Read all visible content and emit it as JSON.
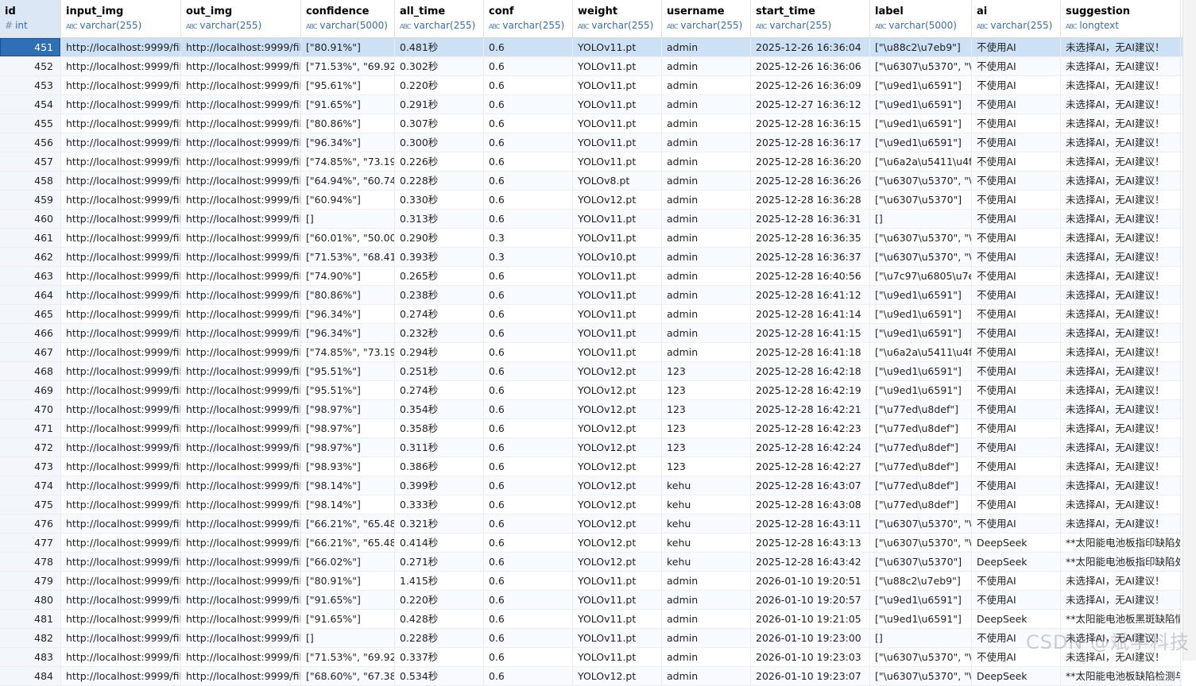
{
  "columns": [
    {
      "name": "id",
      "type": "int",
      "icon": "#"
    },
    {
      "name": "input_img",
      "type": "varchar(255)",
      "icon": "ABC"
    },
    {
      "name": "out_img",
      "type": "varchar(255)",
      "icon": "ABC"
    },
    {
      "name": "confidence",
      "type": "varchar(5000)",
      "icon": "ABC"
    },
    {
      "name": "all_time",
      "type": "varchar(255)",
      "icon": "ABC"
    },
    {
      "name": "conf",
      "type": "varchar(255)",
      "icon": "ABC"
    },
    {
      "name": "weight",
      "type": "varchar(255)",
      "icon": "ABC"
    },
    {
      "name": "username",
      "type": "varchar(255)",
      "icon": "ABC"
    },
    {
      "name": "start_time",
      "type": "varchar(255)",
      "icon": "ABC"
    },
    {
      "name": "label",
      "type": "varchar(5000)",
      "icon": "ABC"
    },
    {
      "name": "ai",
      "type": "varchar(255)",
      "icon": "ABC"
    },
    {
      "name": "suggestion",
      "type": "longtext",
      "icon": "ABC"
    }
  ],
  "rows": [
    [
      "451",
      "http://localhost:9999/file",
      "http://localhost:9999/file",
      "[\"80.91%\"]",
      "0.481秒",
      "0.6",
      "YOLOv11.pt",
      "admin",
      "2025-12-26 16:36:04",
      "[\"\\u88c2\\u7eb9\"]",
      "不使用AI",
      "未选择AI，无AI建议！"
    ],
    [
      "452",
      "http://localhost:9999/file",
      "http://localhost:9999/file",
      "[\"71.53%\", \"69.92%",
      "0.302秒",
      "0.6",
      "YOLOv11.pt",
      "admin",
      "2025-12-26 16:36:06",
      "[\"\\u6307\\u5370\", \"\\u",
      "不使用AI",
      "未选择AI，无AI建议！"
    ],
    [
      "453",
      "http://localhost:9999/file",
      "http://localhost:9999/file",
      "[\"95.61%\"]",
      "0.220秒",
      "0.6",
      "YOLOv11.pt",
      "admin",
      "2025-12-26 16:36:09",
      "[\"\\u9ed1\\u6591\"]",
      "不使用AI",
      "未选择AI，无AI建议！"
    ],
    [
      "454",
      "http://localhost:9999/file",
      "http://localhost:9999/file",
      "[\"91.65%\"]",
      "0.291秒",
      "0.6",
      "YOLOv11.pt",
      "admin",
      "2025-12-27 16:36:12",
      "[\"\\u9ed1\\u6591\"]",
      "不使用AI",
      "未选择AI，无AI建议！"
    ],
    [
      "455",
      "http://localhost:9999/file",
      "http://localhost:9999/file",
      "[\"80.86%\"]",
      "0.307秒",
      "0.6",
      "YOLOv11.pt",
      "admin",
      "2025-12-28 16:36:15",
      "[\"\\u9ed1\\u6591\"]",
      "不使用AI",
      "未选择AI，无AI建议！"
    ],
    [
      "456",
      "http://localhost:9999/file",
      "http://localhost:9999/file",
      "[\"96.34%\"]",
      "0.300秒",
      "0.6",
      "YOLOv11.pt",
      "admin",
      "2025-12-28 16:36:17",
      "[\"\\u9ed1\\u6591\"]",
      "不使用AI",
      "未选择AI，无AI建议！"
    ],
    [
      "457",
      "http://localhost:9999/file",
      "http://localhost:9999/file",
      "[\"74.85%\", \"73.19%",
      "0.226秒",
      "0.6",
      "YOLOv11.pt",
      "admin",
      "2025-12-28 16:36:20",
      "[\"\\u6a2a\\u5411\\u4f4",
      "不使用AI",
      "未选择AI，无AI建议！"
    ],
    [
      "458",
      "http://localhost:9999/file",
      "http://localhost:9999/file",
      "[\"64.94%\", \"60.74%",
      "0.228秒",
      "0.6",
      "YOLOv8.pt",
      "admin",
      "2025-12-28 16:36:26",
      "[\"\\u6307\\u5370\", \"\\u",
      "不使用AI",
      "未选择AI，无AI建议！"
    ],
    [
      "459",
      "http://localhost:9999/file",
      "http://localhost:9999/file",
      "[\"60.94%\"]",
      "0.330秒",
      "0.6",
      "YOLOv12.pt",
      "admin",
      "2025-12-28 16:36:28",
      "[\"\\u6307\\u5370\"]",
      "不使用AI",
      "未选择AI，无AI建议！"
    ],
    [
      "460",
      "http://localhost:9999/file",
      "http://localhost:9999/file",
      "[]",
      "0.313秒",
      "0.6",
      "YOLOv11.pt",
      "admin",
      "2025-12-28 16:36:31",
      "[]",
      "不使用AI",
      "未选择AI，无AI建议！"
    ],
    [
      "461",
      "http://localhost:9999/file",
      "http://localhost:9999/file",
      "[\"60.01%\", \"50.00%",
      "0.290秒",
      "0.3",
      "YOLOv11.pt",
      "admin",
      "2025-12-28 16:36:35",
      "[\"\\u6307\\u5370\", \"\\u",
      "不使用AI",
      "未选择AI，无AI建议！"
    ],
    [
      "462",
      "http://localhost:9999/file",
      "http://localhost:9999/file",
      "[\"71.53%\", \"68.41%",
      "0.393秒",
      "0.3",
      "YOLOv10.pt",
      "admin",
      "2025-12-28 16:36:37",
      "[\"\\u6307\\u5370\", \"\\u",
      "不使用AI",
      "未选择AI，无AI建议！"
    ],
    [
      "463",
      "http://localhost:9999/file",
      "http://localhost:9999/file",
      "[\"74.90%\"]",
      "0.265秒",
      "0.6",
      "YOLOv11.pt",
      "admin",
      "2025-12-28 16:40:56",
      "[\"\\u7c97\\u6805\\u7eb",
      "不使用AI",
      "未选择AI，无AI建议！"
    ],
    [
      "464",
      "http://localhost:9999/file",
      "http://localhost:9999/file",
      "[\"80.86%\"]",
      "0.238秒",
      "0.6",
      "YOLOv11.pt",
      "admin",
      "2025-12-28 16:41:12",
      "[\"\\u9ed1\\u6591\"]",
      "不使用AI",
      "未选择AI，无AI建议！"
    ],
    [
      "465",
      "http://localhost:9999/file",
      "http://localhost:9999/file",
      "[\"96.34%\"]",
      "0.274秒",
      "0.6",
      "YOLOv11.pt",
      "admin",
      "2025-12-28 16:41:14",
      "[\"\\u9ed1\\u6591\"]",
      "不使用AI",
      "未选择AI，无AI建议！"
    ],
    [
      "466",
      "http://localhost:9999/file",
      "http://localhost:9999/file",
      "[\"96.34%\"]",
      "0.232秒",
      "0.6",
      "YOLOv11.pt",
      "admin",
      "2025-12-28 16:41:15",
      "[\"\\u9ed1\\u6591\"]",
      "不使用AI",
      "未选择AI，无AI建议！"
    ],
    [
      "467",
      "http://localhost:9999/file",
      "http://localhost:9999/file",
      "[\"74.85%\", \"73.19%",
      "0.294秒",
      "0.6",
      "YOLOv11.pt",
      "admin",
      "2025-12-28 16:41:18",
      "[\"\\u6a2a\\u5411\\u4f4",
      "不使用AI",
      "未选择AI，无AI建议！"
    ],
    [
      "468",
      "http://localhost:9999/file",
      "http://localhost:9999/file",
      "[\"95.51%\"]",
      "0.251秒",
      "0.6",
      "YOLOv12.pt",
      "123",
      "2025-12-28 16:42:18",
      "[\"\\u9ed1\\u6591\"]",
      "不使用AI",
      "未选择AI，无AI建议！"
    ],
    [
      "469",
      "http://localhost:9999/file",
      "http://localhost:9999/file",
      "[\"95.51%\"]",
      "0.274秒",
      "0.6",
      "YOLOv12.pt",
      "123",
      "2025-12-28 16:42:19",
      "[\"\\u9ed1\\u6591\"]",
      "不使用AI",
      "未选择AI，无AI建议！"
    ],
    [
      "470",
      "http://localhost:9999/file",
      "http://localhost:9999/file",
      "[\"98.97%\"]",
      "0.354秒",
      "0.6",
      "YOLOv12.pt",
      "123",
      "2025-12-28 16:42:21",
      "[\"\\u77ed\\u8def\"]",
      "不使用AI",
      "未选择AI，无AI建议！"
    ],
    [
      "471",
      "http://localhost:9999/file",
      "http://localhost:9999/file",
      "[\"98.97%\"]",
      "0.358秒",
      "0.6",
      "YOLOv12.pt",
      "123",
      "2025-12-28 16:42:23",
      "[\"\\u77ed\\u8def\"]",
      "不使用AI",
      "未选择AI，无AI建议！"
    ],
    [
      "472",
      "http://localhost:9999/file",
      "http://localhost:9999/file",
      "[\"98.97%\"]",
      "0.311秒",
      "0.6",
      "YOLOv12.pt",
      "123",
      "2025-12-28 16:42:24",
      "[\"\\u77ed\\u8def\"]",
      "不使用AI",
      "未选择AI，无AI建议！"
    ],
    [
      "473",
      "http://localhost:9999/file",
      "http://localhost:9999/file",
      "[\"98.93%\"]",
      "0.386秒",
      "0.6",
      "YOLOv12.pt",
      "123",
      "2025-12-28 16:42:27",
      "[\"\\u77ed\\u8def\"]",
      "不使用AI",
      "未选择AI，无AI建议！"
    ],
    [
      "474",
      "http://localhost:9999/file",
      "http://localhost:9999/file",
      "[\"98.14%\"]",
      "0.399秒",
      "0.6",
      "YOLOv12.pt",
      "kehu",
      "2025-12-28 16:43:07",
      "[\"\\u77ed\\u8def\"]",
      "不使用AI",
      "未选择AI，无AI建议！"
    ],
    [
      "475",
      "http://localhost:9999/file",
      "http://localhost:9999/file",
      "[\"98.14%\"]",
      "0.333秒",
      "0.6",
      "YOLOv12.pt",
      "kehu",
      "2025-12-28 16:43:08",
      "[\"\\u77ed\\u8def\"]",
      "不使用AI",
      "未选择AI，无AI建议！"
    ],
    [
      "476",
      "http://localhost:9999/file",
      "http://localhost:9999/file",
      "[\"66.21%\", \"65.48%",
      "0.321秒",
      "0.6",
      "YOLOv12.pt",
      "kehu",
      "2025-12-28 16:43:11",
      "[\"\\u6307\\u5370\", \"\\u",
      "不使用AI",
      "未选择AI，无AI建议！"
    ],
    [
      "477",
      "http://localhost:9999/file",
      "http://localhost:9999/file",
      "[\"66.21%\", \"65.48%",
      "0.414秒",
      "0.6",
      "YOLOv12.pt",
      "kehu",
      "2025-12-28 16:43:13",
      "[\"\\u6307\\u5370\", \"\\u",
      "DeepSeek",
      "**太阳能电池板指印缺陷处"
    ],
    [
      "478",
      "http://localhost:9999/file",
      "http://localhost:9999/file",
      "[\"66.02%\"]",
      "0.271秒",
      "0.6",
      "YOLOv12.pt",
      "kehu",
      "2025-12-28 16:43:42",
      "[\"\\u6307\\u5370\"]",
      "DeepSeek",
      "**太阳能电池板指印缺陷处"
    ],
    [
      "479",
      "http://localhost:9999/file",
      "http://localhost:9999/file",
      "[\"80.91%\"]",
      "1.415秒",
      "0.6",
      "YOLOv11.pt",
      "admin",
      "2026-01-10 19:20:51",
      "[\"\\u88c2\\u7eb9\"]",
      "不使用AI",
      "未选择AI，无AI建议！"
    ],
    [
      "480",
      "http://localhost:9999/file",
      "http://localhost:9999/file",
      "[\"91.65%\"]",
      "0.220秒",
      "0.6",
      "YOLOv11.pt",
      "admin",
      "2026-01-10 19:20:57",
      "[\"\\u9ed1\\u6591\"]",
      "不使用AI",
      "未选择AI，无AI建议！"
    ],
    [
      "481",
      "http://localhost:9999/file",
      "http://localhost:9999/file",
      "[\"91.65%\"]",
      "0.428秒",
      "0.6",
      "YOLOv11.pt",
      "admin",
      "2026-01-10 19:21:05",
      "[\"\\u9ed1\\u6591\"]",
      "DeepSeek",
      "**太阳能电池板黑斑缺陷情"
    ],
    [
      "482",
      "http://localhost:9999/file",
      "http://localhost:9999/file",
      "[]",
      "0.228秒",
      "0.6",
      "YOLOv11.pt",
      "admin",
      "2026-01-10 19:23:00",
      "[]",
      "不使用AI",
      "未选择AI，无AI建议！"
    ],
    [
      "483",
      "http://localhost:9999/file",
      "http://localhost:9999/file",
      "[\"71.53%\", \"69.92%",
      "0.337秒",
      "0.6",
      "YOLOv11.pt",
      "admin",
      "2026-01-10 19:23:03",
      "[\"\\u6307\\u5370\", \"\\u",
      "不使用AI",
      "未选择AI，无AI建议！"
    ],
    [
      "484",
      "http://localhost:9999/file",
      "http://localhost:9999/file",
      "[\"68.60%\", \"67.38%",
      "0.534秒",
      "0.6",
      "YOLOv12.pt",
      "admin",
      "2026-01-10 19:23:07",
      "[\"\\u6307\\u5370\", \"\\u",
      "DeepSeek",
      "**太阳能电池板缺陷检测与"
    ]
  ],
  "selected_row": "451",
  "watermark": "CSDN @斌学科技"
}
